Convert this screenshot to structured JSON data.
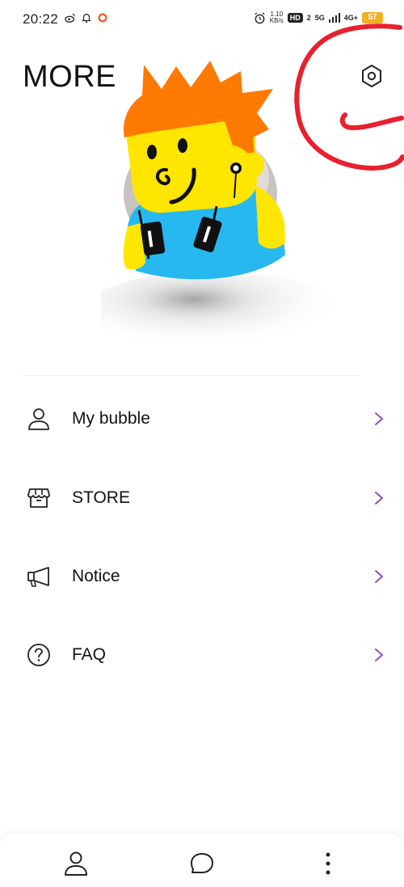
{
  "status_bar": {
    "time": "20:22",
    "speed_value": "1.10",
    "speed_unit": "KB/s",
    "hd": "HD",
    "hd_sub": "2",
    "net_5g": "5G",
    "net_4g": "4G+",
    "battery": "57"
  },
  "header": {
    "title": "MORE",
    "settings_icon": "gear-hexagon-icon"
  },
  "menu": {
    "items": [
      {
        "label": "My bubble",
        "icon": "person-icon"
      },
      {
        "label": "STORE",
        "icon": "store-icon"
      },
      {
        "label": "Notice",
        "icon": "megaphone-icon"
      },
      {
        "label": "FAQ",
        "icon": "question-icon"
      }
    ]
  },
  "colors": {
    "chevron": "#8e4fc4",
    "annotation": "#e8202f",
    "hair": "#ff7a00",
    "skin": "#ffe600",
    "shirt": "#27b8f0"
  },
  "bottom_nav": {
    "items": [
      "profile-icon",
      "chat-bubble-icon",
      "more-vertical-icon"
    ]
  }
}
